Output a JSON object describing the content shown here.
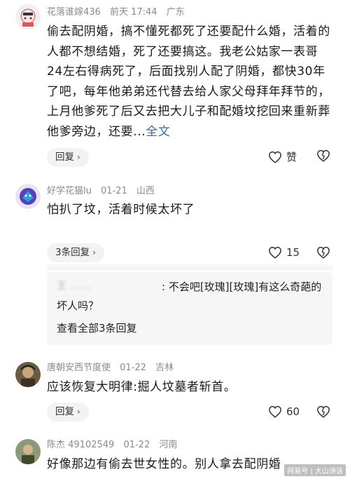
{
  "comments": [
    {
      "username": "花落谁嫁436",
      "time": "前天 17:44",
      "location": "广东",
      "text": "偷去配阴婚，搞不懂死都死了还要配什么婚，活着的人都不想结婚，死了还要搞这。我老公姑家一表哥24左右得病死了，后面找别人配了阴婚，都快30年了吧，每年他弟弟还代替去给人家父母拜年拜节的，上月他爹死了后又去把大儿子和配婚坟挖回来重新葬他爹旁边，还要...",
      "full_text_link": "全文",
      "reply_label": "回复",
      "like_label": "赞"
    },
    {
      "username": "好学花猫lu",
      "time": "01-21",
      "location": "山西",
      "text": "怕扒了坟，活着时候太坏了",
      "reply_label": "3条回复",
      "like_count": "15",
      "sub_reply": {
        "author_blurred": "王 ... ...",
        "text": ": 不会吧[玫瑰][玫瑰]有这么奇葩的坏人吗？",
        "view_all": "查看全部3条回复"
      }
    },
    {
      "username": "唐朝安西节度使",
      "time": "01-22",
      "location": "吉林",
      "text": "应该恢复大明律:掘人坟墓者斩首。",
      "reply_label": "回复",
      "like_count": "60"
    },
    {
      "username": "陈杰 49102549",
      "time": "01-22",
      "location": "河南",
      "text": "好像那边有偷去世女性的。别人拿去配阴婚"
    }
  ],
  "watermark": "网易号 | 大山诗话",
  "colors": {
    "meta": "#8a8a8a",
    "link": "#3a6aa8",
    "pill_bg": "#f3f3f3"
  },
  "icons": [
    "heart-icon",
    "broken-heart-icon",
    "chevron-right-icon"
  ]
}
